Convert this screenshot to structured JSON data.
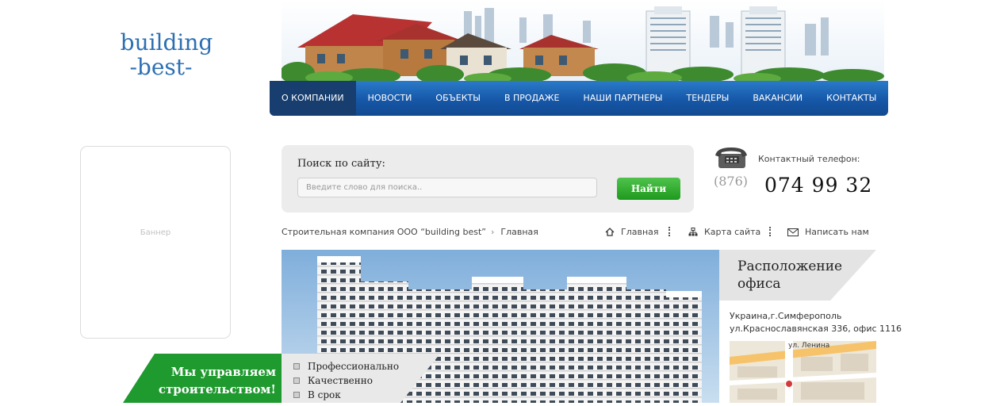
{
  "logo": {
    "line1": "building",
    "line2": "-best-"
  },
  "nav": {
    "items": [
      {
        "label": "О КОМПАНИИ",
        "active": true
      },
      {
        "label": "НОВОСТИ"
      },
      {
        "label": "ОБЪЕКТЫ"
      },
      {
        "label": "В ПРОДАЖЕ"
      },
      {
        "label": "НАШИ ПАРТНЕРЫ"
      },
      {
        "label": "ТЕНДЕРЫ"
      },
      {
        "label": "ВАКАНСИИ"
      },
      {
        "label": "КОНТАКТЫ"
      }
    ]
  },
  "banner": {
    "label": "Баннер"
  },
  "search": {
    "title": "Поиск по сайту:",
    "placeholder": "Введите слово для поиска..",
    "button": "Найти"
  },
  "contacts": {
    "label": "Контактный телефон:",
    "code": "(876)",
    "number": "074 99 32"
  },
  "breadcrumb": {
    "company": "Строительная компания ООО “building best”",
    "separator": "›",
    "current": "Главная"
  },
  "util_links": {
    "home": "Главная",
    "sitemap": "Карта сайта",
    "write": "Написать нам"
  },
  "office": {
    "title_line1": "Расположение",
    "title_line2": "офиса",
    "address_line1": "Украина,г.Симферополь",
    "address_line2": "ул.Краснославянская 336, офис 1116",
    "map_street": "ул. Ленина"
  },
  "slogan": {
    "line1": "Мы управляем",
    "line2": "строительством!",
    "features": [
      "Профессионально",
      "Качественно",
      "В срок"
    ]
  },
  "colors": {
    "brand_blue": "#1f66b6",
    "accent_green": "#1f9a1d",
    "logo_blue": "#2c6fb3"
  }
}
